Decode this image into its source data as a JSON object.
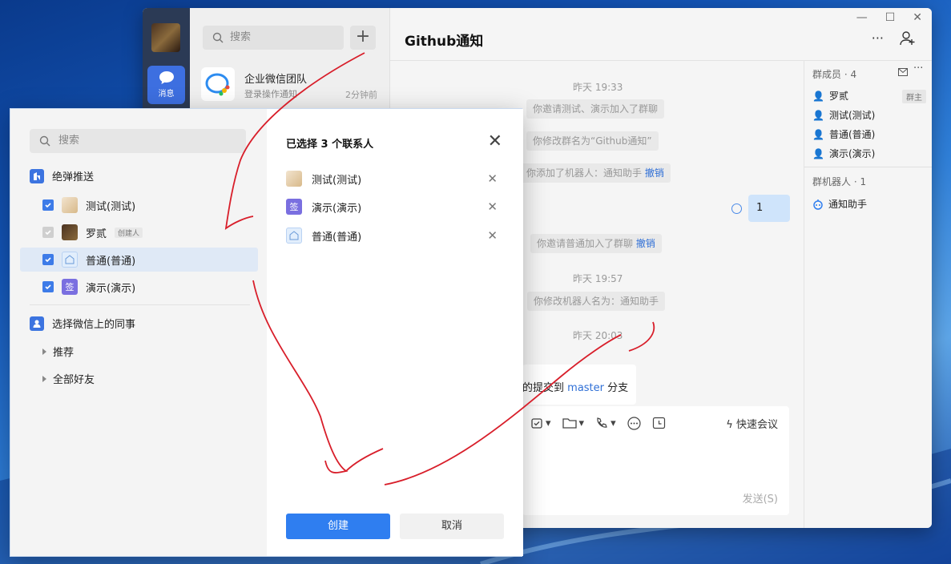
{
  "app": {
    "nav_label": "消息",
    "search_placeholder": "搜索",
    "conversation": {
      "name": "企业微信团队",
      "preview": "登录操作通知",
      "time": "2分钟前"
    },
    "chat_title": "Github通知"
  },
  "chat": {
    "time1": "昨天 19:33",
    "sys1": "你邀请测试、演示加入了群聊",
    "sys2": "你修改群名为“Github通知”",
    "sys3": "你添加了机器人：通知助手",
    "undo": "撤销",
    "my_message": "1",
    "sys4": "你邀请普通加入了群聊",
    "time2": "昨天 19:57",
    "sys5": "你修改机器人名为：通知助手",
    "time3": "昨天 20:03",
    "card_prefix": "的提交到",
    "card_branch": "master",
    "card_suffix": "分支",
    "quick_meeting": "快速会议",
    "send_label": "发送(S)"
  },
  "members": {
    "header": "群成员 · 4",
    "list": [
      "罗贰",
      "测试(测试)",
      "普通(普通)",
      "演示(演示)"
    ],
    "owner_tag": "群主",
    "robot_header": "群机器人 · 1",
    "robot": "通知助手"
  },
  "dialog": {
    "search_placeholder": "搜索",
    "department": "绝弹推送",
    "rows": [
      {
        "name": "测试(测试)"
      },
      {
        "name": "罗贰",
        "tag": "创建人"
      },
      {
        "name": "普通(普通)"
      },
      {
        "name": "演示(演示)"
      }
    ],
    "wechat_colleagues": "选择微信上的同事",
    "tree": [
      "推荐",
      "全部好友"
    ],
    "selected_title": "已选择 3 个联系人",
    "selected": [
      "测试(测试)",
      "演示(演示)",
      "普通(普通)"
    ],
    "create_label": "创建",
    "cancel_label": "取消",
    "avatar_glyph_sign": "签"
  },
  "colors": {
    "accent": "#2f7ef0",
    "rail": "#2b3a55",
    "annotation": "#d81e2a"
  }
}
